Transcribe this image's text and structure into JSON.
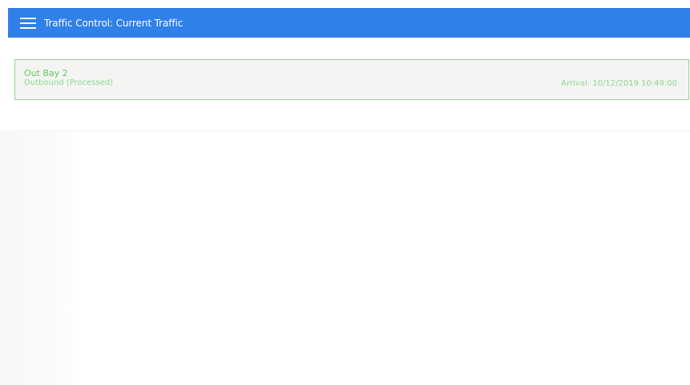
{
  "header": {
    "title": "Traffic Control: Current Traffic",
    "menu_icon": "menu-icon",
    "background": "#2f80e9"
  },
  "traffic": [
    {
      "title": "Out Bay 2",
      "status": "Outbound (Processed)",
      "arrival": "Arrival: 10/12/2019 10:49:00",
      "accent": "#67c25d"
    }
  ]
}
